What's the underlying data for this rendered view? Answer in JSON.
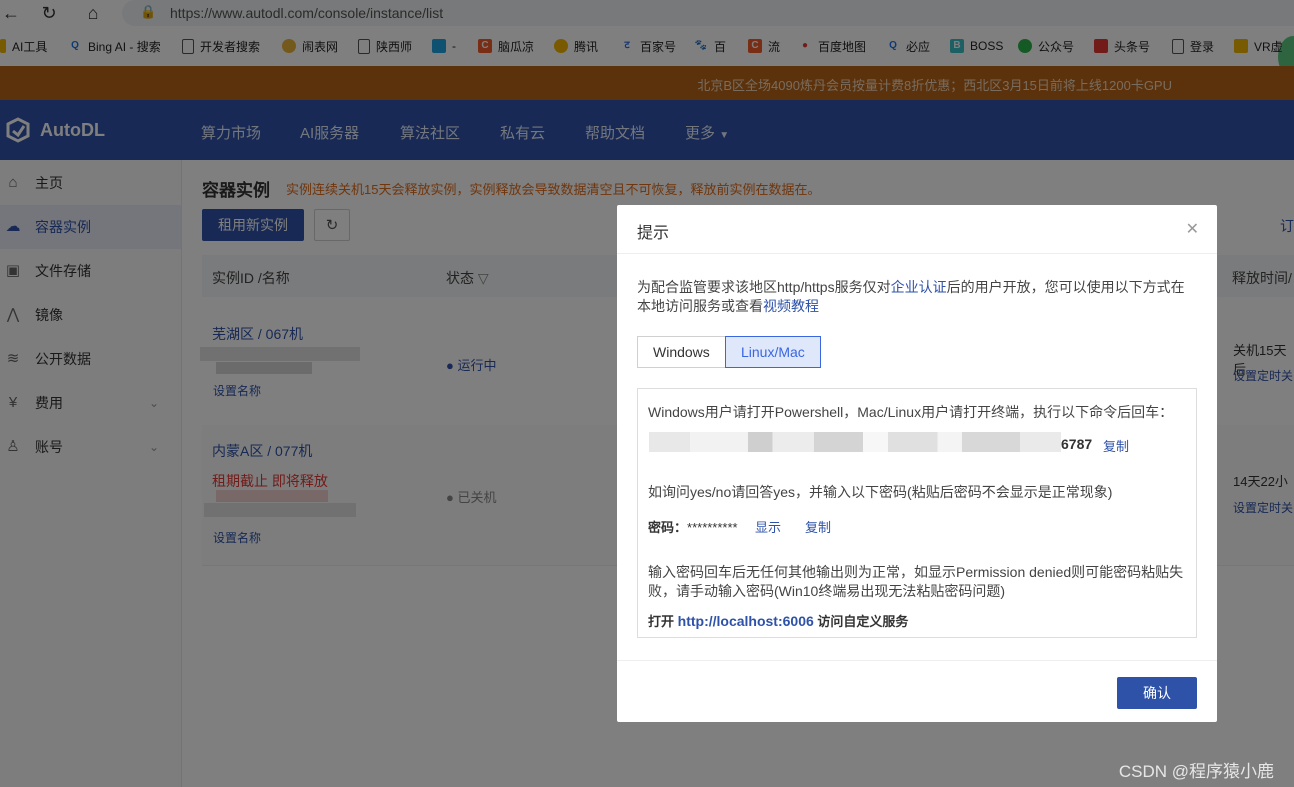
{
  "browser": {
    "url": "https://www.autodl.com/console/instance/list",
    "bookmarks": [
      "AI工具",
      "Bing AI - 搜索",
      "开发者搜索",
      "闹表网",
      "陕西师",
      "-",
      "脑瓜凉",
      "腾讯",
      "百家号",
      "百",
      "流",
      "百度地图",
      "必应",
      "BOSS",
      "公众号",
      "头条号",
      "登录",
      "VR虚"
    ]
  },
  "announcement": "北京B区全场4090炼丹会员按量计费8折优惠；西北区3月15日前将上线1200卡GPU",
  "header": {
    "logo": "AutoDL",
    "nav": [
      "算力市场",
      "AI服务器",
      "算法社区",
      "私有云",
      "帮助文档",
      "更多"
    ]
  },
  "sidebar": {
    "items": [
      {
        "label": "主页"
      },
      {
        "label": "容器实例"
      },
      {
        "label": "文件存储"
      },
      {
        "label": "镜像"
      },
      {
        "label": "公开数据"
      },
      {
        "label": "费用"
      },
      {
        "label": "账号"
      }
    ]
  },
  "main": {
    "title": "容器实例",
    "warning": "实例连续关机15天会释放实例，实例释放会导致数据清空且不可恢复，释放前实例在数据在。",
    "rent_button": "租用新实例",
    "headers": {
      "id": "实例ID /名称",
      "status": "状态",
      "release": "释放时间/"
    },
    "right_link": "订",
    "rows": [
      {
        "name": "芜湖区 / 067机",
        "set_name": "设置名称",
        "status": "● 运行中",
        "release": "关机15天后",
        "release_link": "设置定时关"
      },
      {
        "name": "内蒙A区 / 077机",
        "note": "租期截止 即将释放",
        "set_name": "设置名称",
        "status": "● 已关机",
        "release": "14天22小",
        "release_link": "设置定时关"
      }
    ]
  },
  "modal": {
    "title": "提示",
    "desc_pre": "为配合监管要求该地区http/https服务仅对",
    "desc_link1": "企业认证",
    "desc_mid": "后的用户开放，您可以使用以下方式在本地访问服务或查看",
    "desc_link2": "视频教程",
    "tabs": [
      "Windows",
      "Linux/Mac"
    ],
    "instruction": "Windows用户请打开Powershell，Mac/Linux用户请打开终端，执行以下命令后回车：",
    "cmd_tail": "6787",
    "copy": "复制",
    "yesno": "如询问yes/no请回答yes，并输入以下密码(粘贴后密码不会显示是正常现象)",
    "pwd_label": "密码：",
    "pwd_mask": "**********",
    "show": "显示",
    "note": "输入密码回车后无任何其他输出则为正常，如显示Permission denied则可能密码粘贴失败，请手动输入密码(Win10终端易出现无法粘贴密码问题)",
    "open_pre": "打开",
    "open_url": "http://localhost:6006",
    "open_post": "访问自定义服务",
    "ok": "确认"
  },
  "watermark": "CSDN @程序猿小鹿"
}
